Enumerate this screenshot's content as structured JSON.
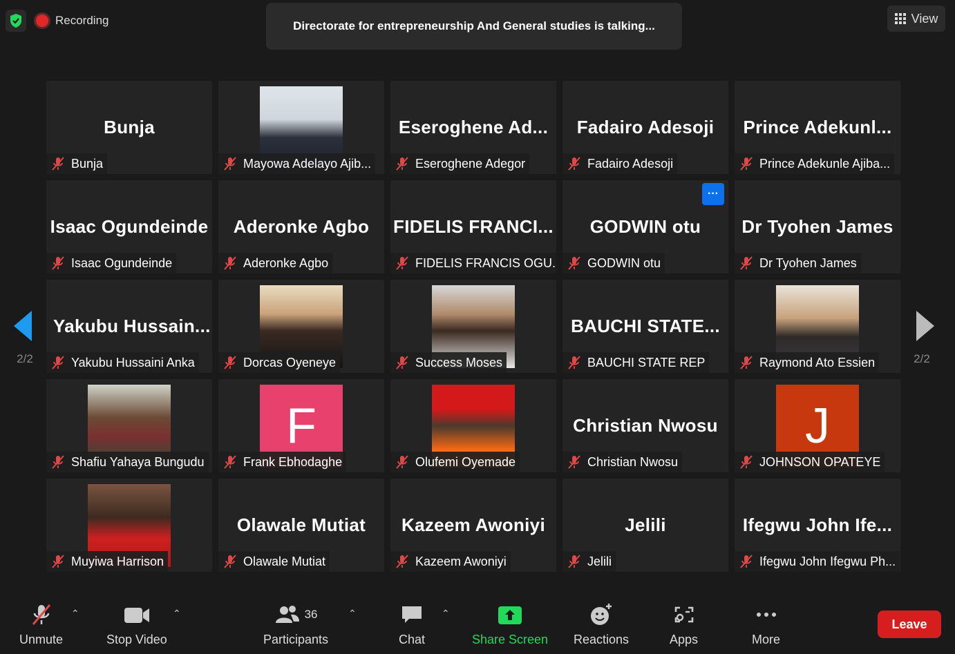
{
  "recording": "Recording",
  "talking": "Directorate for entrepreneurship And General studies is talking...",
  "view_label": "View",
  "page_indicator_left": "2/2",
  "page_indicator_right": "2/2",
  "tiles": [
    {
      "big": "Bunja",
      "name": "Bunja"
    },
    {
      "big": "",
      "name": "Mayowa Adelayo Ajib..."
    },
    {
      "big": "Eseroghene  Ad...",
      "name": "Eseroghene Adegor"
    },
    {
      "big": "Fadairo Adesoji",
      "name": "Fadairo Adesoji"
    },
    {
      "big": "Prince  Adekunl...",
      "name": "Prince Adekunle Ajiba..."
    },
    {
      "big": "Isaac Ogundeinde",
      "name": "Isaac Ogundeinde"
    },
    {
      "big": "Aderonke Agbo",
      "name": "Aderonke Agbo"
    },
    {
      "big": "FIDELIS  FRANCI...",
      "name": "FIDELIS FRANCIS OGU..."
    },
    {
      "big": "GODWIN otu",
      "name": "GODWIN otu",
      "more": "···"
    },
    {
      "big": "Dr Tyohen James",
      "name": "Dr Tyohen James"
    },
    {
      "big": "Yakubu  Hussain...",
      "name": "Yakubu Hussaini Anka"
    },
    {
      "big": "",
      "name": "Dorcas Oyeneye"
    },
    {
      "big": "",
      "name": "Success Moses"
    },
    {
      "big": "BAUCHI  STATE...",
      "name": "BAUCHI STATE REP"
    },
    {
      "big": "",
      "name": "Raymond Ato Essien"
    },
    {
      "big": "",
      "name": "Shafiu Yahaya Bungudu"
    },
    {
      "big": "",
      "name": "Frank Ebhodaghe",
      "letter": "F"
    },
    {
      "big": "",
      "name": "Olufemi Oyemade"
    },
    {
      "big": "Christian Nwosu",
      "name": "Christian Nwosu"
    },
    {
      "big": "",
      "name": "JOHNSON OPATEYE",
      "letter": "J"
    },
    {
      "big": "",
      "name": "Muyiwa Harrison"
    },
    {
      "big": "Olawale Mutiat",
      "name": "Olawale Mutiat"
    },
    {
      "big": "Kazeem Awoniyi",
      "name": "Kazeem Awoniyi"
    },
    {
      "big": "Jelili",
      "name": "Jelili"
    },
    {
      "big": "Ifegwu  John  Ife...",
      "name": "Ifegwu John Ifegwu Ph..."
    }
  ],
  "toolbar": {
    "unmute": "Unmute",
    "stop_video": "Stop Video",
    "participants": "Participants",
    "participants_count": "36",
    "chat": "Chat",
    "share_screen": "Share Screen",
    "reactions": "Reactions",
    "apps": "Apps",
    "more": "More",
    "leave": "Leave"
  },
  "colors": {
    "accent_green": "#23d959",
    "leave_red": "#d61e1e",
    "more_blue": "#0e71eb",
    "mute_red": "#e04848",
    "avatar_pink": "#e8416d",
    "avatar_orange": "#c8380f"
  }
}
